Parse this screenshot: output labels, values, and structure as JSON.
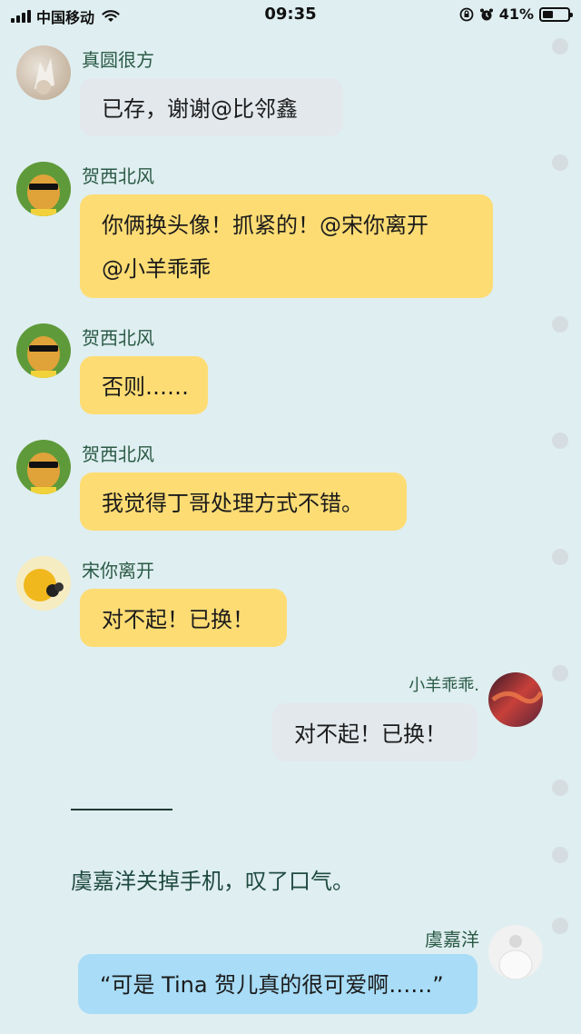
{
  "status_bar": {
    "carrier": "中国移动",
    "time": "09:35",
    "battery_percent_label": "41%",
    "battery_level": 0.41
  },
  "messages": [
    {
      "sender": "真圆很方",
      "text": "已存，谢谢@比邻鑫"
    },
    {
      "sender": "贺西北风",
      "text_line1": "你俩换头像！抓紧的！@宋你离开",
      "text_line2": "@小羊乖乖"
    },
    {
      "sender": "贺西北风",
      "text": "否则……"
    },
    {
      "sender": "贺西北风",
      "text": "我觉得丁哥处理方式不错。"
    },
    {
      "sender": "宋你离开",
      "text": "对不起！已换！"
    },
    {
      "sender": "小羊乖乖.",
      "text": "对不起！已换！"
    },
    {
      "sender": "虞嘉洋",
      "text": "“可是 Tina 贺儿真的很可爱啊……”"
    }
  ],
  "narration": "虞嘉洋关掉手机，叹了口气。",
  "colors": {
    "background": "#dfeef0",
    "bubble_gray": "#e3e8ec",
    "bubble_yellow": "#fddc74",
    "bubble_blue": "#a8dcf7",
    "name_green": "#2a5a45"
  },
  "icons": [
    "signal-icon",
    "wifi-icon",
    "rotation-lock-icon",
    "alarm-icon",
    "battery-icon"
  ]
}
